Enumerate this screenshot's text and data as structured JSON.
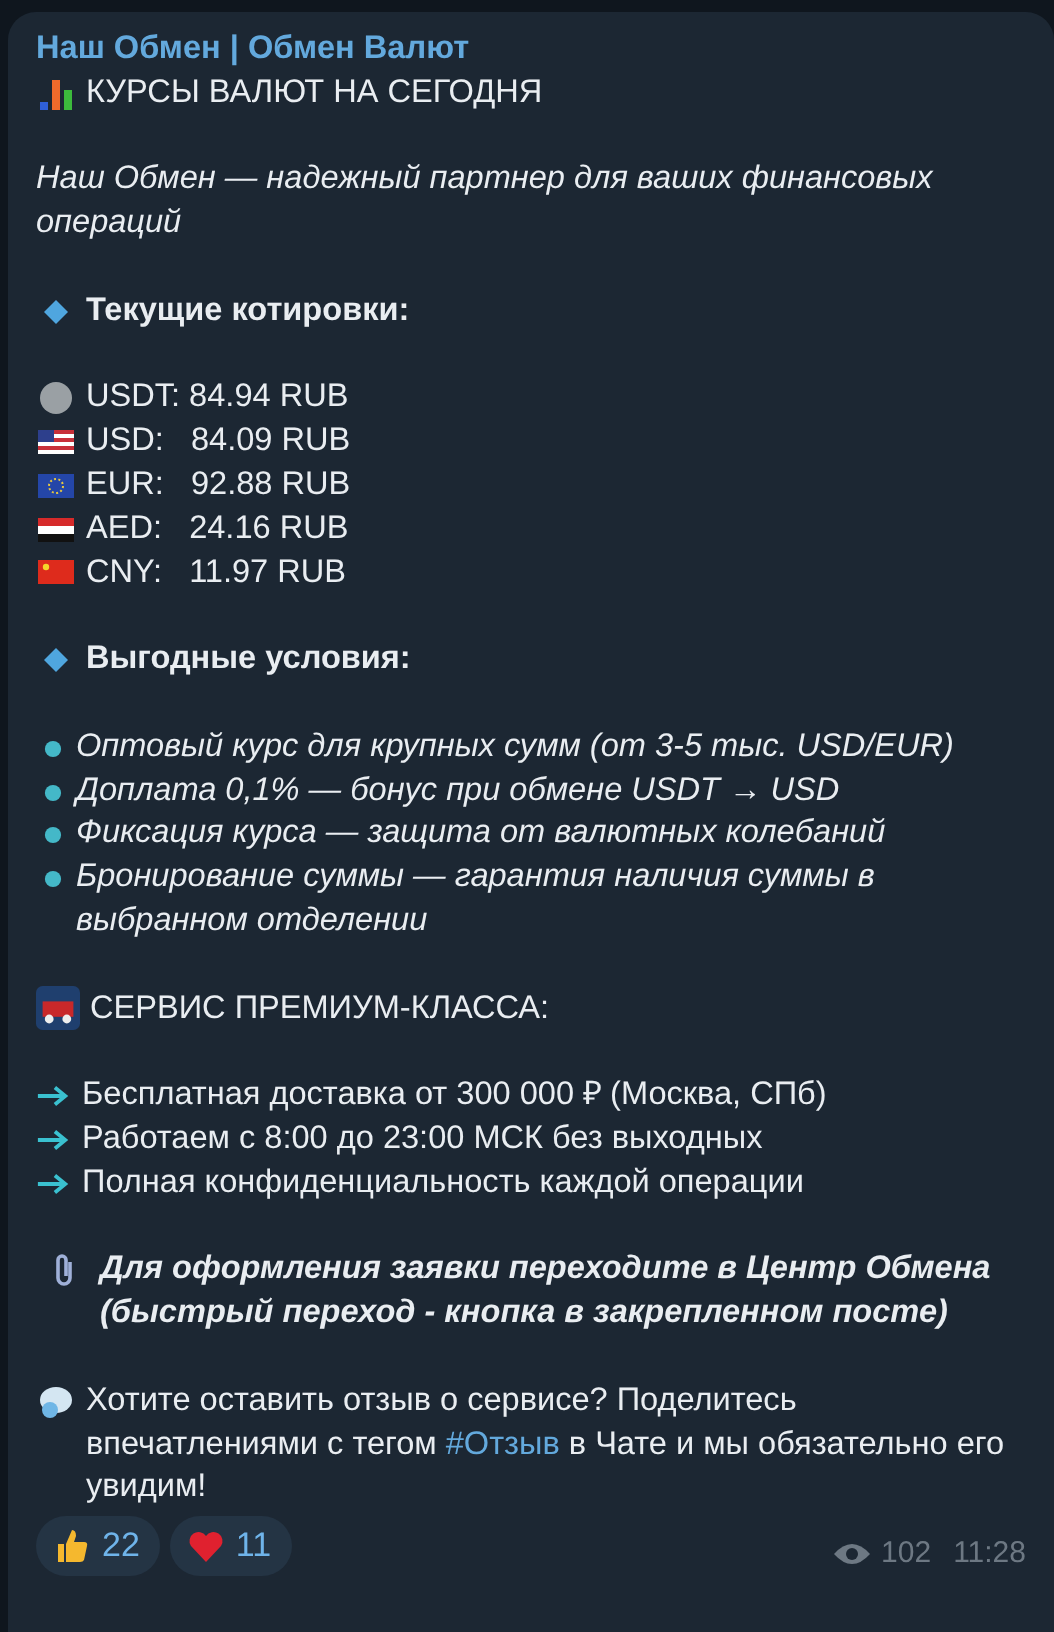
{
  "channel": "Наш Обмен | Обмен Валют",
  "title": "КУРСЫ ВАЛЮТ НА СЕГОДНЯ",
  "intro": "Наш Обмен — надежный партнер для ваших финансовых операций",
  "rates_heading": "Текущие котировки:",
  "rates": [
    {
      "kind": "coin",
      "text": "USDT: 84.94 RUB"
    },
    {
      "kind": "us",
      "text": "USD:   84.09 RUB"
    },
    {
      "kind": "eu",
      "text": "EUR:   92.88 RUB"
    },
    {
      "kind": "ae",
      "text": "AED:   24.16 RUB"
    },
    {
      "kind": "cn",
      "text": "CNY:   11.97 RUB"
    }
  ],
  "conditions_heading": "Выгодные условия:",
  "conditions": [
    "Оптовый курс для крупных сумм (от 3-5 тыс. USD/EUR)",
    "Доплата 0,1% — бонус при обмене USDT → USD",
    "Фиксация курса — защита от валютных колебаний",
    "Бронирование суммы — гарантия наличия суммы в выбранном отделении"
  ],
  "service_heading": "СЕРВИС ПРЕМИУМ-КЛАССА:",
  "services": [
    "Бесплатная доставка от 300 000 ₽ (Москва, СПб)",
    "Работаем с 8:00 до 23:00 МСК без выходных",
    "Полная конфиденциальность каждой операции"
  ],
  "note": "Для оформления заявки переходите в Центр Обмена (быстрый переход - кнопка в закрепленном посте)",
  "feedback": {
    "before": "Хотите оставить отзыв о сервисе? Поделитесь впечатлениями с тегом",
    "tag": "#Отзыв",
    "after": "в Чате и мы обязательно его увидим!"
  },
  "reactions": [
    {
      "kind": "thumbs",
      "count": "22"
    },
    {
      "kind": "heart",
      "count": "11"
    }
  ],
  "views": "102",
  "time": "11:28"
}
